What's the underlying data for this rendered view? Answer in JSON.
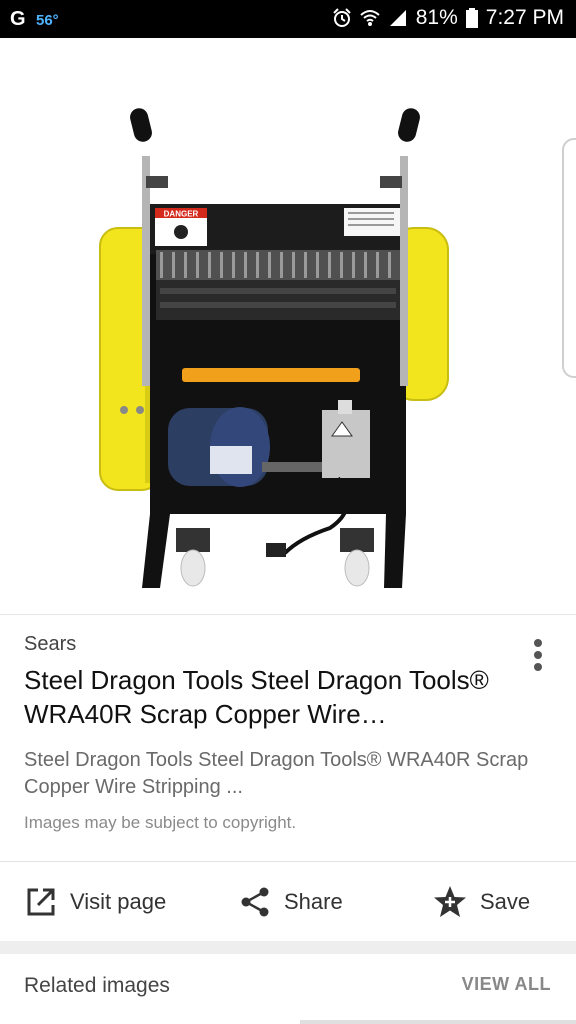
{
  "status_bar": {
    "google_glyph": "G",
    "temperature": "56°",
    "battery": "81%",
    "time": "7:27 PM"
  },
  "image": {
    "labels": {
      "danger": "DANGER"
    },
    "colors": {
      "housing": "#f2e51d",
      "frame": "#111111",
      "motor": "#2d3e63"
    }
  },
  "result": {
    "source": "Sears",
    "title": "Steel Dragon Tools Steel Dragon Tools® WRA40R Scrap Copper Wire…",
    "description": "Steel Dragon Tools Steel Dragon Tools® WRA40R Scrap Copper Wire Stripping ...",
    "copyright": "Images may be subject to copyright."
  },
  "actions": {
    "visit": "Visit page",
    "share": "Share",
    "save": "Save"
  },
  "related": {
    "label": "Related images",
    "view_all": "VIEW ALL"
  },
  "icons": {
    "alarm": "alarm-icon",
    "wifi": "wifi-icon",
    "signal": "signal-icon",
    "battery": "battery-icon",
    "visit": "open-in-new-icon",
    "share": "share-icon",
    "save": "star-icon",
    "more": "more-vert-icon"
  }
}
